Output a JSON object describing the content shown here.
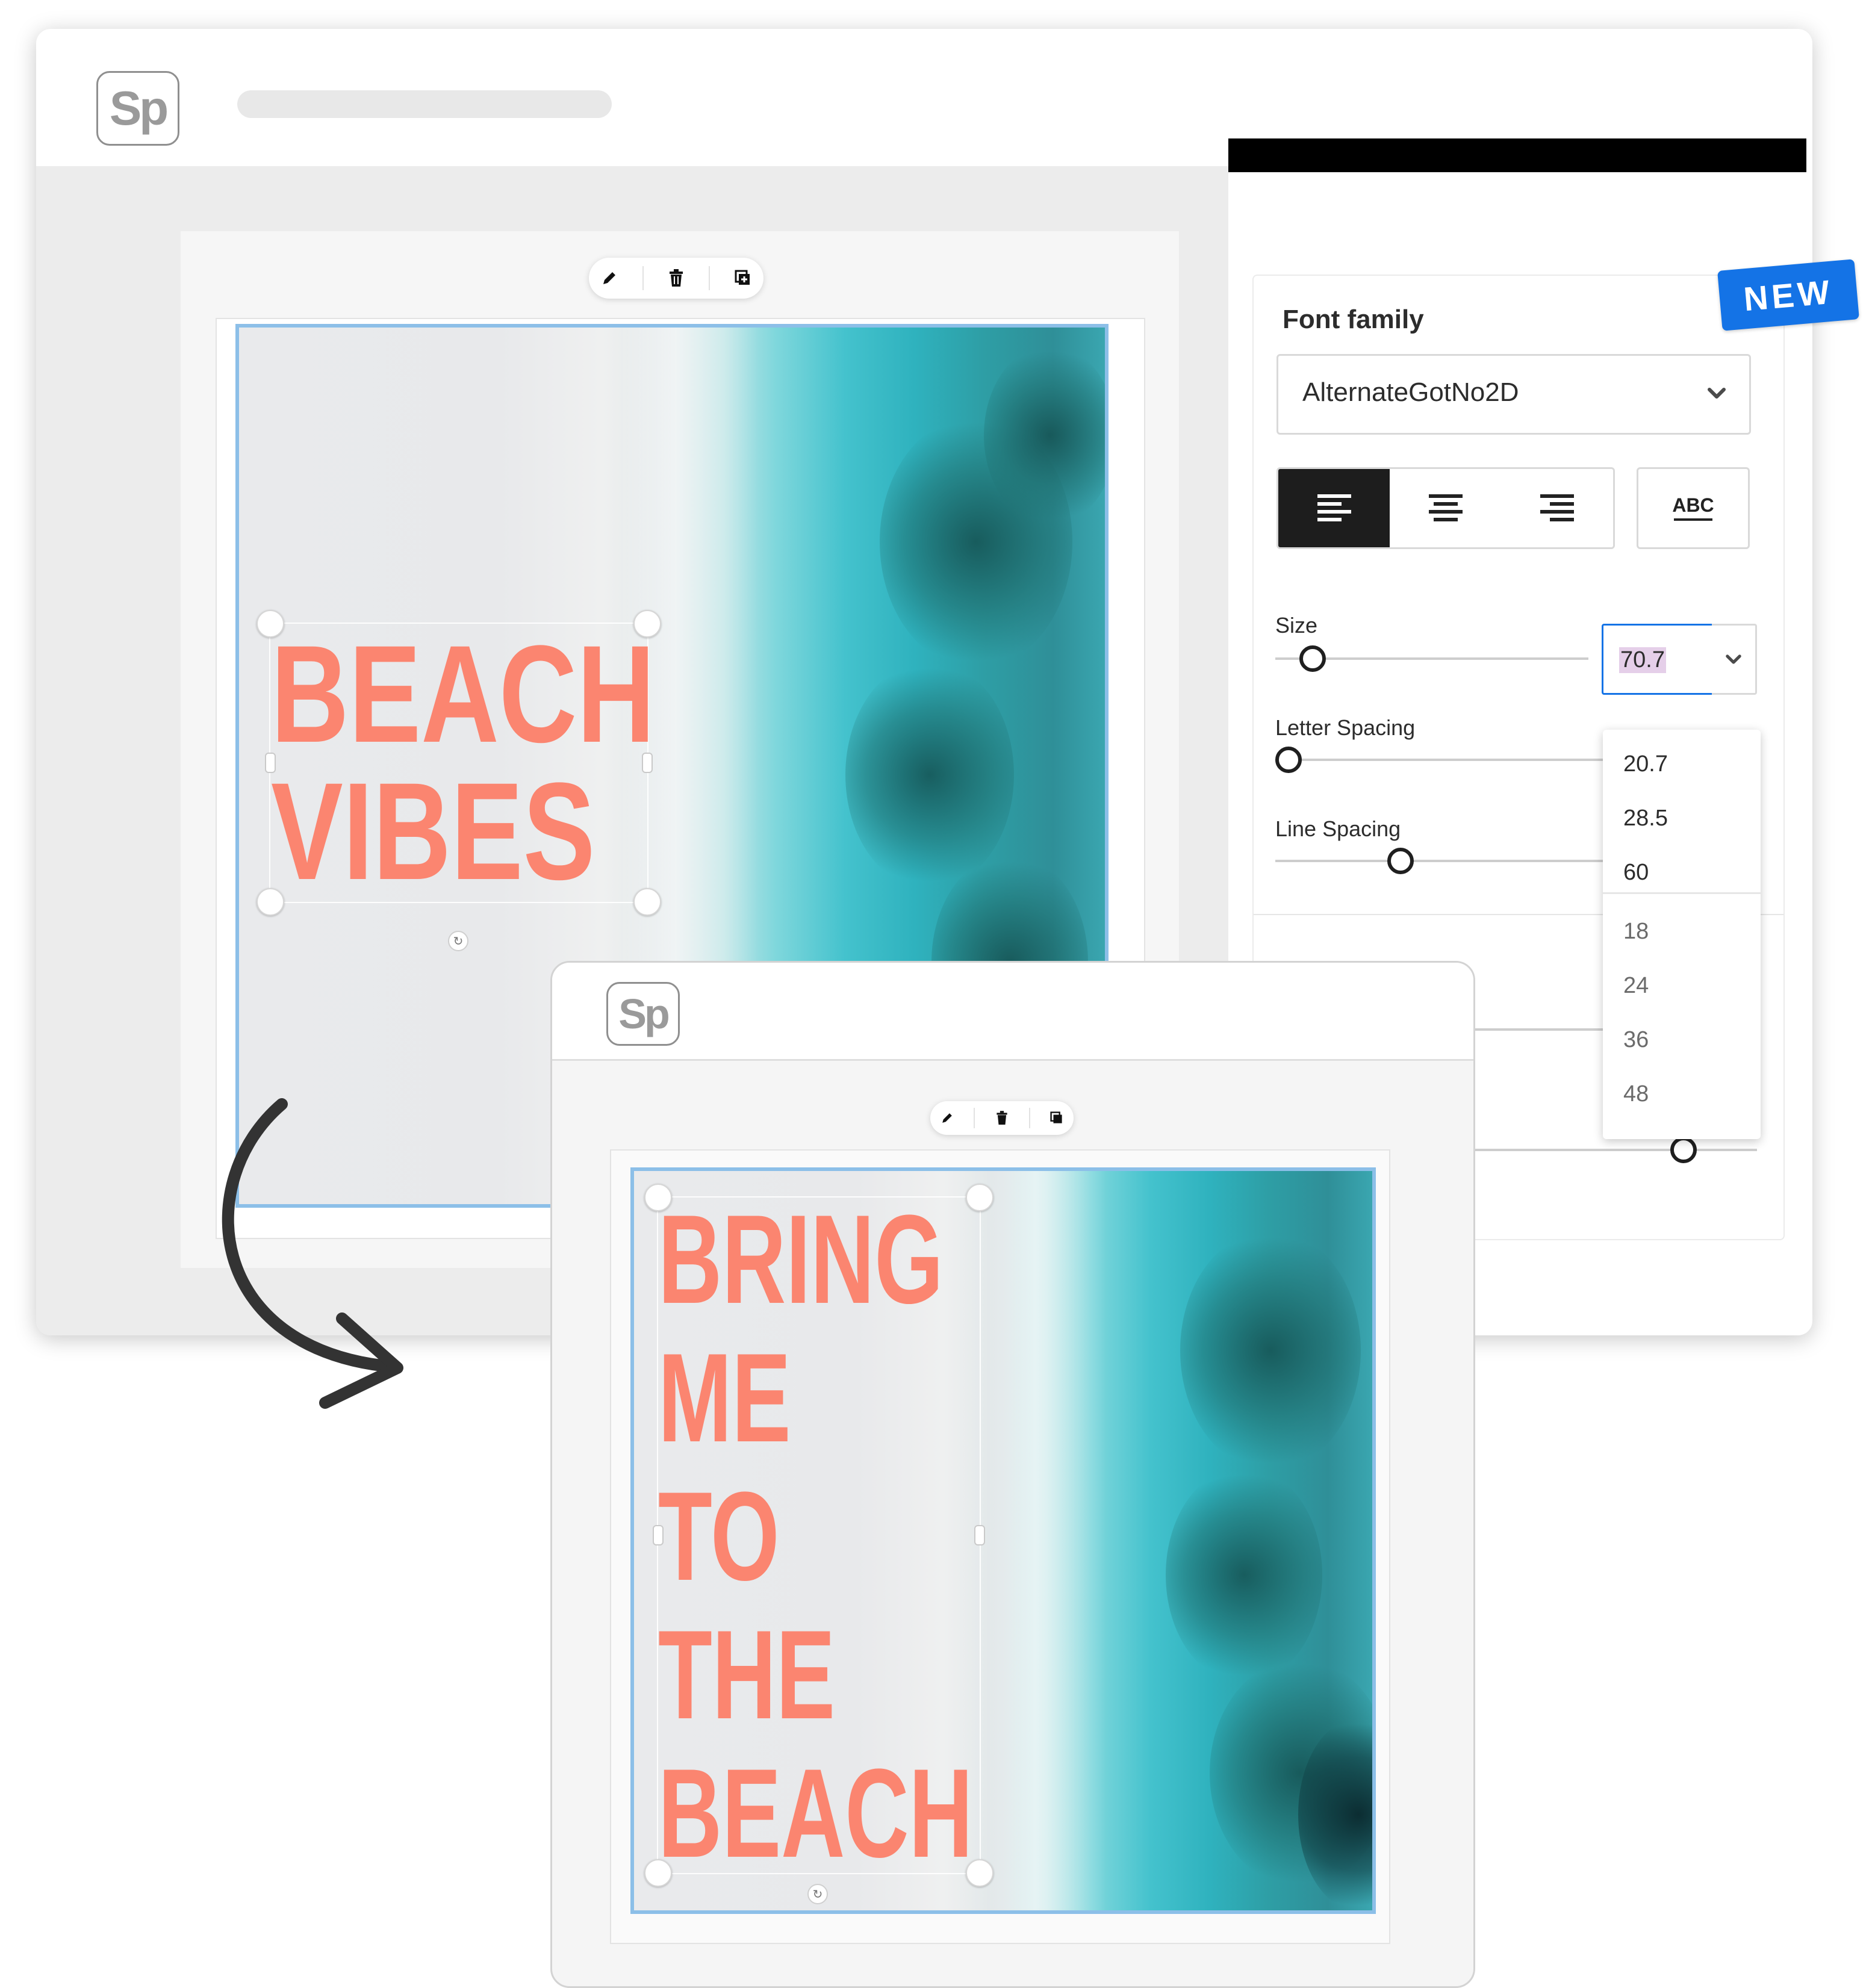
{
  "app": {
    "logo_text": "Sp"
  },
  "main_window": {
    "toolbar": {
      "edit_icon": "pencil-icon",
      "delete_icon": "trash-icon",
      "duplicate_icon": "duplicate-icon"
    },
    "headline": {
      "line1": "BEACH",
      "line2": "VIBES"
    }
  },
  "panel": {
    "badge": "NEW",
    "font_family_label": "Font family",
    "font_family_value": "AlternateGotNo2D",
    "alignment": {
      "selected": "left",
      "options": [
        "left",
        "center",
        "right"
      ]
    },
    "abc_label": "ABC",
    "size_label": "Size",
    "size_value": "70.7",
    "letter_spacing_label": "Letter Spacing",
    "line_spacing_label": "Line Spacing",
    "size_slider_level": 0.12,
    "letter_spacing_slider_level": 0.0,
    "line_spacing_slider_level": 0.4,
    "size_options_recent": [
      "20.7",
      "28.5",
      "60"
    ],
    "size_options_preset": [
      "18",
      "24",
      "36",
      "48"
    ]
  },
  "second_window": {
    "headline": {
      "line1": "BRING",
      "line2": "ME",
      "line3": "TO",
      "line4": "THE",
      "line5": "BEACH"
    }
  },
  "colors": {
    "accent": "#1473e6",
    "headline": "#fb8570",
    "selection": "#8cbfe8"
  }
}
